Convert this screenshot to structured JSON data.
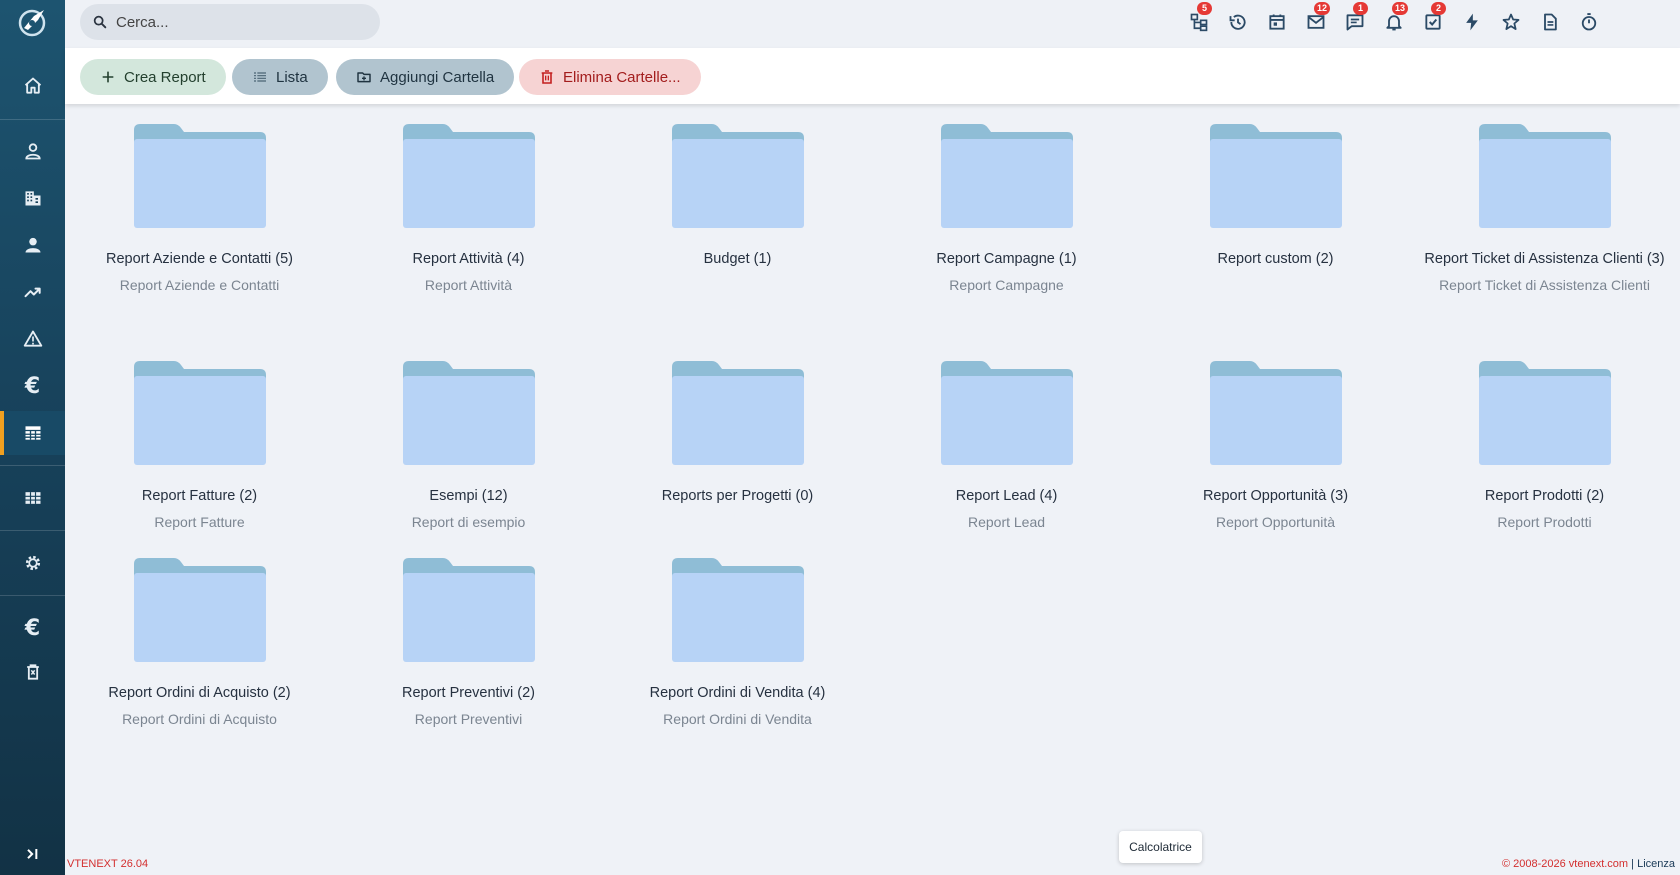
{
  "search": {
    "placeholder": "Cerca..."
  },
  "notifications": {
    "hierarchy": "5",
    "mail": "12",
    "chat": "1",
    "bell": "13",
    "tasks": "2"
  },
  "toolbar": {
    "create_label": "Crea Report",
    "list_label": "Lista",
    "add_folder_label": "Aggiungi Cartella",
    "delete_folders_label": "Elimina Cartelle..."
  },
  "folders": [
    {
      "name": "Report Aziende e Contatti (5)",
      "description": "Report Aziende e Contatti"
    },
    {
      "name": "Report Attività (4)",
      "description": "Report Attività"
    },
    {
      "name": "Budget (1)",
      "description": ""
    },
    {
      "name": "Report Campagne (1)",
      "description": "Report Campagne"
    },
    {
      "name": "Report custom (2)",
      "description": ""
    },
    {
      "name": "Report Ticket di Assistenza Clienti (3)",
      "description": "Report Ticket di Assistenza Clienti"
    },
    {
      "name": "Report Fatture (2)",
      "description": "Report Fatture"
    },
    {
      "name": "Esempi (12)",
      "description": "Report di esempio"
    },
    {
      "name": "Reports per Progetti (0)",
      "description": ""
    },
    {
      "name": "Report Lead (4)",
      "description": "Report Lead"
    },
    {
      "name": "Report Opportunità (3)",
      "description": "Report Opportunità"
    },
    {
      "name": "Report Prodotti (2)",
      "description": "Report Prodotti"
    },
    {
      "name": "Report Ordini di Acquisto (2)",
      "description": "Report Ordini di Acquisto"
    },
    {
      "name": "Report Preventivi (2)",
      "description": "Report Preventivi"
    },
    {
      "name": "Report Ordini di Vendita (4)",
      "description": "Report Ordini di Vendita"
    }
  ],
  "footer": {
    "version": "VTENEXT 26.04",
    "copyright": "© 2008-2026 vtenext.com",
    "separator": " | ",
    "license": "Licenza",
    "calculator": "Calcolatrice"
  },
  "colors": {
    "accent": "#f0a020",
    "sidebar": "#17415a",
    "badge": "#e53935",
    "folder_front": "#b7d3f6",
    "folder_back": "#8fbdd6"
  }
}
